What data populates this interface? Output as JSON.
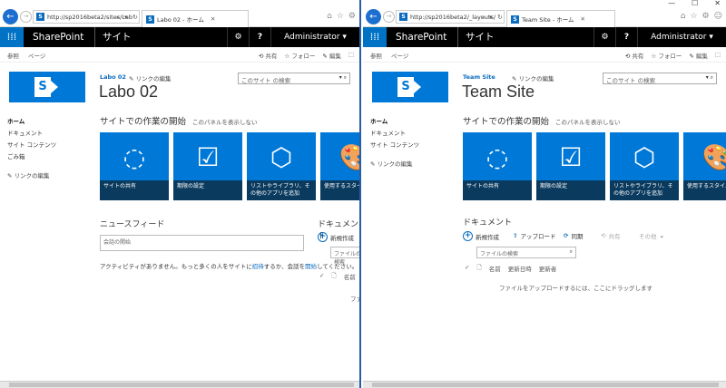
{
  "window": {
    "minimize": "—",
    "maximize": "☐",
    "close": "✕"
  },
  "left": {
    "address": "http://sp2016beta2/sites/Lab",
    "tab_title": "Labo 02 - ホーム",
    "suite": {
      "brand": "SharePoint",
      "site_word": "サイト",
      "user": "Administrator"
    },
    "commands": {
      "browse": "参照",
      "page": "ページ",
      "share": "共有",
      "follow": "フォロー",
      "edit": "編集"
    },
    "header": {
      "site_link": "Labo 02",
      "edit_links": "リンクの編集",
      "title": "Labo 02",
      "search_placeholder": "このサイト の検索"
    },
    "nav": [
      "ホーム",
      "ドキュメント",
      "サイト コンテンツ",
      "ごみ箱"
    ],
    "nav_edit": "リンクの編集",
    "getting_started": {
      "title": "サイトでの作業の開始",
      "hide": "このパネルを表示しない"
    },
    "tiles": [
      "サイトの共有",
      "期限の設定",
      "リストやライブラリ、その他のアプリを追加",
      "使用するスタイル"
    ],
    "newsfeed": {
      "title": "ニュースフィード",
      "placeholder": "会話の開始",
      "activity_a": "アクティビティがありません。もっと多くの人をサイトに",
      "activity_invite": "招待",
      "activity_b": "するか、会話を",
      "activity_start": "開始",
      "activity_c": "してください。"
    },
    "documents": {
      "title": "ドキュメント",
      "new": "新規作成",
      "search": "ファイルの検索",
      "name_col": "名前",
      "drop_hint": "ファイ"
    }
  },
  "right": {
    "address": "http://sp2016beta2/_layouts/",
    "tab_title": "Team Site - ホーム",
    "suite": {
      "brand": "SharePoint",
      "site_word": "サイト",
      "user": "Administrator"
    },
    "commands": {
      "browse": "参照",
      "page": "ページ",
      "share": "共有",
      "follow": "フォロー",
      "edit": "編集"
    },
    "header": {
      "site_link": "Team Site",
      "edit_links": "リンクの編集",
      "title": "Team Site",
      "search_placeholder": "このサイト の検索"
    },
    "nav": [
      "ホーム",
      "ドキュメント",
      "サイト コンテンツ"
    ],
    "nav_edit": "リンクの編集",
    "getting_started": {
      "title": "サイトでの作業の開始",
      "hide": "このパネルを表示しない"
    },
    "tiles": [
      "サイトの共有",
      "期限の設定",
      "リストやライブラリ、その他のアプリを追加",
      "使用するスタイル"
    ],
    "documents": {
      "title": "ドキュメント",
      "new": "新規作成",
      "upload": "アップロード",
      "sync": "同期",
      "share": "共有",
      "more": "その他",
      "search": "ファイルの検索",
      "name_col": "名前",
      "modified_col": "更新日時",
      "modified_by_col": "更新者",
      "drop_hint": "ファイルをアップロードするには、ここにドラッグします"
    }
  }
}
